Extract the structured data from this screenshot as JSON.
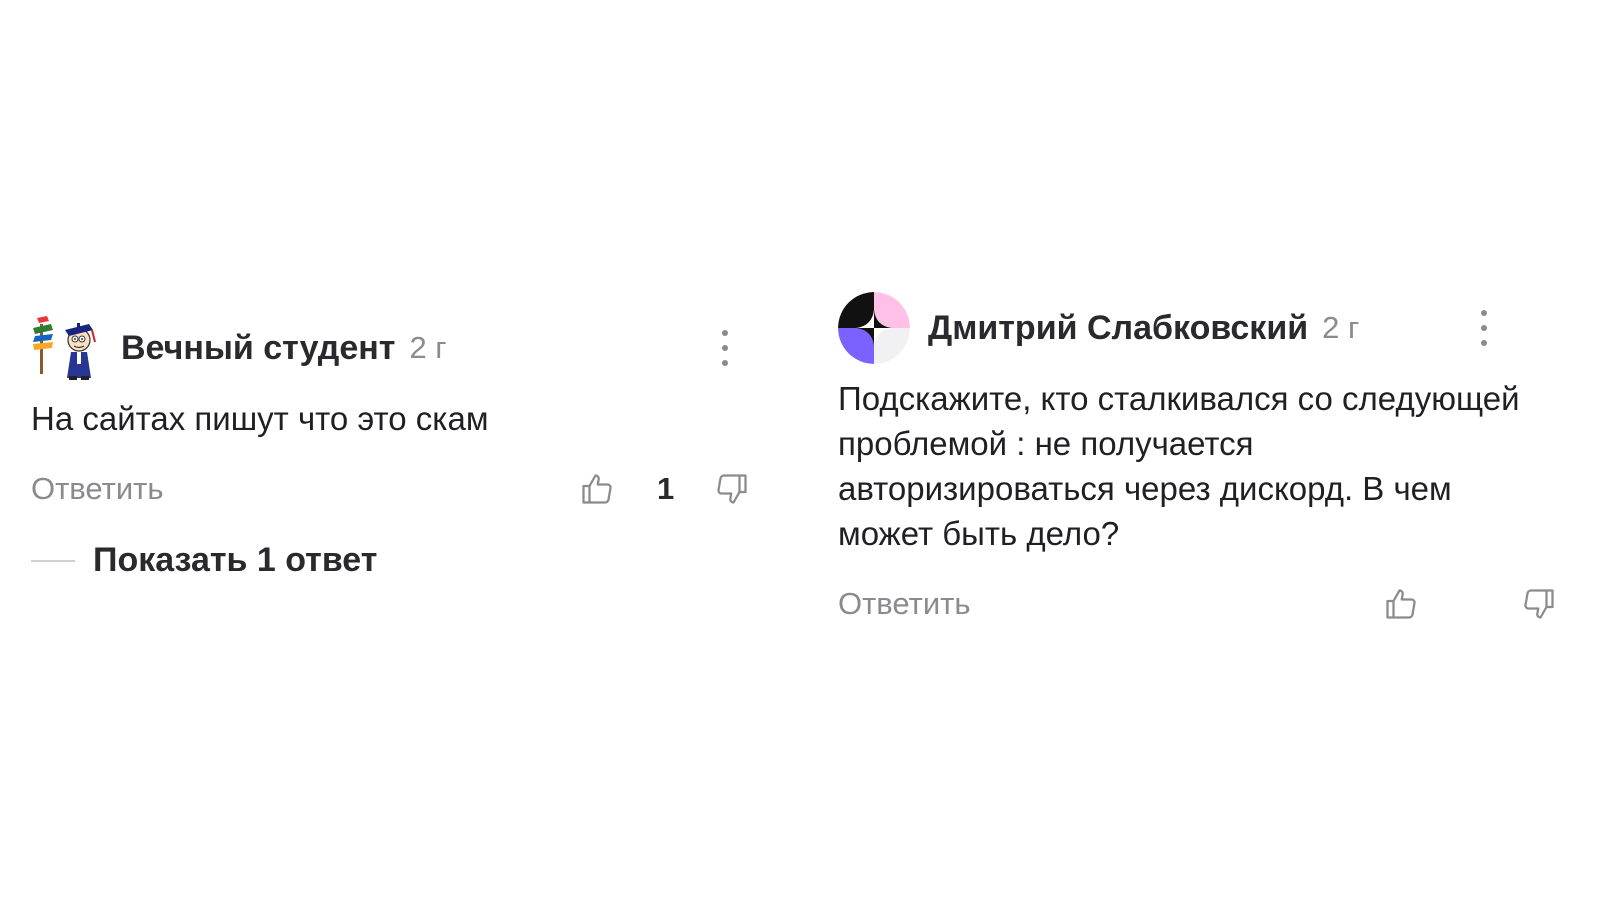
{
  "comments": [
    {
      "author": "Вечный студент",
      "age": "2 г",
      "text": "На сайтах пишут что это скам",
      "reply_label": "Ответить",
      "likes": "1",
      "show_replies_label": "Показать 1 ответ",
      "avatar_icon": "student-cartoon-avatar",
      "menu_icon": "more-vertical-icon"
    },
    {
      "author": "Дмитрий Слабковский",
      "age": "2 г",
      "text": "Подскажите, кто сталкивался со следующей проблемой : не получается авторизироваться через дискорд. В чем может быть дело?",
      "reply_label": "Ответить",
      "avatar_icon": "sparkle-avatar",
      "menu_icon": "more-vertical-icon",
      "avatar_colors": [
        "#111111",
        "#ffc0e8",
        "#7b61ff",
        "#f1f1f4"
      ]
    }
  ],
  "colors": {
    "text_primary": "#1f1f24",
    "text_secondary": "#8a8a90",
    "background": "#ffffff"
  }
}
